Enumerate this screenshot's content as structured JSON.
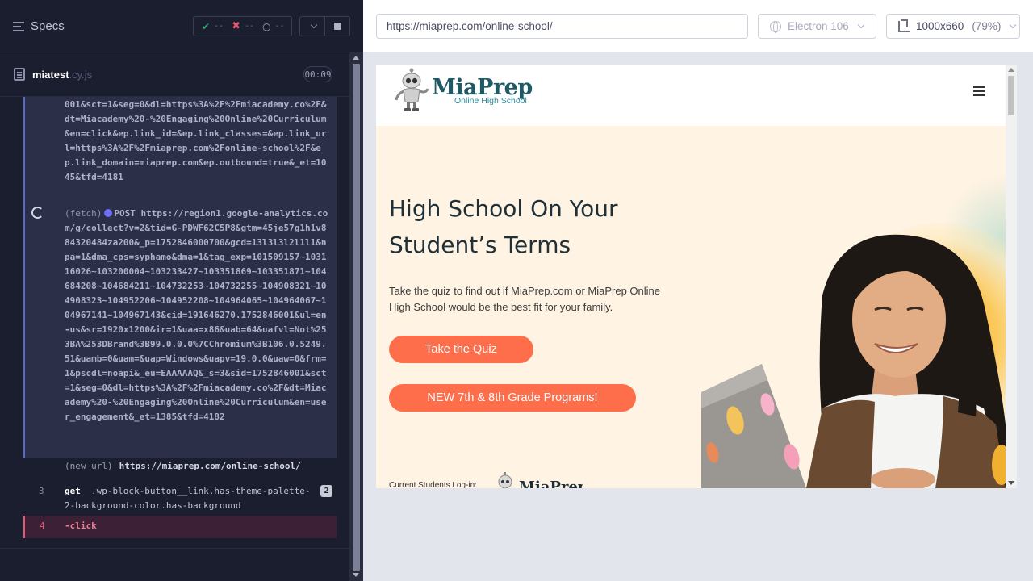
{
  "runner": {
    "title": "Specs",
    "stats": {
      "passed": "--",
      "failed": "--",
      "pending": "--"
    },
    "file": {
      "name": "miatest",
      "ext": ".cy.js",
      "time": "00:09"
    }
  },
  "commands": {
    "prev_tail": "001&sct=1&seg=0&dl=https%3A%2F%2Fmiacademy.co%2F&dt=Miacademy%20-%20Engaging%20Online%20Curriculum&en=click&ep.link_id=&ep.link_classes=&ep.link_url=https%3A%2F%2Fmiaprep.com%2Fonline-school%2F&ep.link_domain=miaprep.com&ep.outbound=true&_et=1045&tfd=4181",
    "fetch_label": "(fetch)",
    "fetch_method": "POST",
    "fetch_url": "https://region1.google-analytics.com/g/collect?v=2&tid=G-PDWF62C5P8&gtm=45je57g1h1v884320484za200&_p=1752846000700&gcd=13l3l3l2l1l1&npa=1&dma_cps=syphamo&dma=1&tag_exp=101509157~103116026~103200004~103233427~103351869~103351871~104684208~104684211~104732253~104732255~104908321~104908323~104952206~104952208~104964065~104964067~104967141~104967143&cid=191646270.1752846001&ul=en-us&sr=1920x1200&ir=1&uaa=x86&uab=64&uafvl=Not%253BA%253DBrand%3B99.0.0.0%7CChromium%3B106.0.5249.51&uamb=0&uam=&uap=Windows&uapv=19.0.0&uaw=0&frm=1&pscdl=noapi&_eu=EAAAAAQ&_s=3&sid=1752846001&sct=1&seg=0&dl=https%3A%2F%2Fmiacademy.co%2F&dt=Miacademy%20-%20Engaging%20Online%20Curriculum&en=user_engagement&_et=1385&tfd=4182",
    "new_url_label": "(new url)",
    "new_url": "https://miaprep.com/online-school/",
    "get_num": "3",
    "get_kw": "get",
    "get_selector": ".wp-block-button__link.has-theme-palette-2-background-color.has-background",
    "get_count": "2",
    "click_num": "4",
    "click_kw": "-click"
  },
  "browser": {
    "url": "https://miaprep.com/online-school/",
    "name": "Electron 106",
    "viewport": "1000x660",
    "zoom": "(79%)"
  },
  "site": {
    "logo": "MiaPrep",
    "logo_sub": "Online High School",
    "headline": "High School On Your Student’s Terms",
    "body": "Take the quiz to find out if MiaPrep.com or MiaPrep Online High School would be the best fit for your family.",
    "btn_quiz": "Take the Quiz",
    "btn_programs": "NEW 7th & 8th Grade Programs!",
    "students_login": "Current Students Log-in:",
    "mini_logo": "MiaPrep"
  },
  "colors": {
    "accent": "#ff6e4a",
    "brand": "#1e5a66",
    "runner_bg": "#1b1e2e"
  }
}
